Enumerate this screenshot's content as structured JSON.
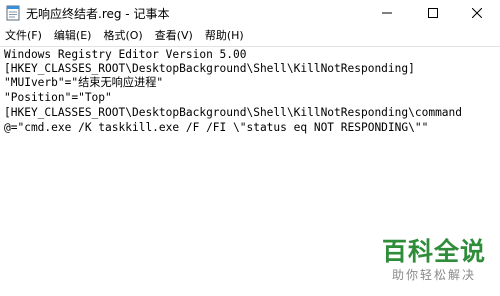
{
  "window": {
    "title": "无响应终结者.reg - 记事本"
  },
  "menu": [
    {
      "label": "文件(F)"
    },
    {
      "label": "编辑(E)"
    },
    {
      "label": "格式(O)"
    },
    {
      "label": "查看(V)"
    },
    {
      "label": "帮助(H)"
    }
  ],
  "editor": {
    "lines": [
      "Windows Registry Editor Version 5.00",
      "[HKEY_CLASSES_ROOT\\DesktopBackground\\Shell\\KillNotResponding]",
      "\"MUIverb\"=\"结束无响应进程\"",
      "\"Position\"=\"Top\"",
      "[HKEY_CLASSES_ROOT\\DesktopBackground\\Shell\\KillNotResponding\\command",
      "@=\"cmd.exe /K taskkill.exe /F /FI \\\"status eq NOT RESPONDING\\\"\""
    ]
  },
  "watermark": {
    "title": "百科全说",
    "subtitle": "助你轻松解决",
    "color": "#2e8c3a"
  },
  "icons": {
    "app": "notepad-icon",
    "minimize": "minimize-icon",
    "maximize": "maximize-icon",
    "close": "close-icon"
  }
}
